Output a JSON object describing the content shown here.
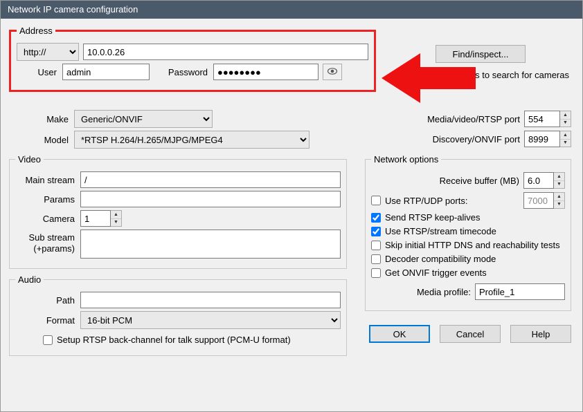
{
  "window": {
    "title": "Network IP camera configuration"
  },
  "address": {
    "legend": "Address",
    "protocol": "http://",
    "ip": "10.0.0.26",
    "user_label": "User",
    "user_value": "admin",
    "password_label": "Password",
    "password_value": "●●●●●●●●"
  },
  "right_top": {
    "find_btn": "Find/inspect...",
    "blank_note_full": "Blank address to search for cameras"
  },
  "make_model": {
    "make_label": "Make",
    "make_value": "Generic/ONVIF",
    "model_label": "Model",
    "model_value": "*RTSP H.264/H.265/MJPG/MPEG4"
  },
  "ports": {
    "rtsp_label": "Media/video/RTSP port",
    "rtsp_value": "554",
    "onvif_label": "Discovery/ONVIF port",
    "onvif_value": "8999"
  },
  "video": {
    "legend": "Video",
    "main_label": "Main stream",
    "main_value": "/",
    "params_label": "Params",
    "params_value": "",
    "camera_label": "Camera",
    "camera_value": "1",
    "sub_label_line1": "Sub stream",
    "sub_label_line2": "(+params)",
    "sub_value": ""
  },
  "audio": {
    "legend": "Audio",
    "path_label": "Path",
    "path_value": "",
    "format_label": "Format",
    "format_value": "16-bit PCM",
    "backchannel_label": "Setup RTSP back-channel for talk support (PCM-U format)"
  },
  "network_options": {
    "legend": "Network options",
    "receive_label": "Receive buffer (MB)",
    "receive_value": "6.0",
    "rtp_label": "Use RTP/UDP ports:",
    "rtp_value": "7000",
    "keepalive_label": "Send RTSP keep-alives",
    "timecode_label": "Use RTSP/stream timecode",
    "skip_dns_label": "Skip initial HTTP DNS and reachability tests",
    "compat_label": "Decoder compatibility mode",
    "trigger_label": "Get ONVIF trigger events",
    "profile_label": "Media profile:",
    "profile_value": "Profile_1"
  },
  "footer": {
    "ok": "OK",
    "cancel": "Cancel",
    "help": "Help"
  }
}
